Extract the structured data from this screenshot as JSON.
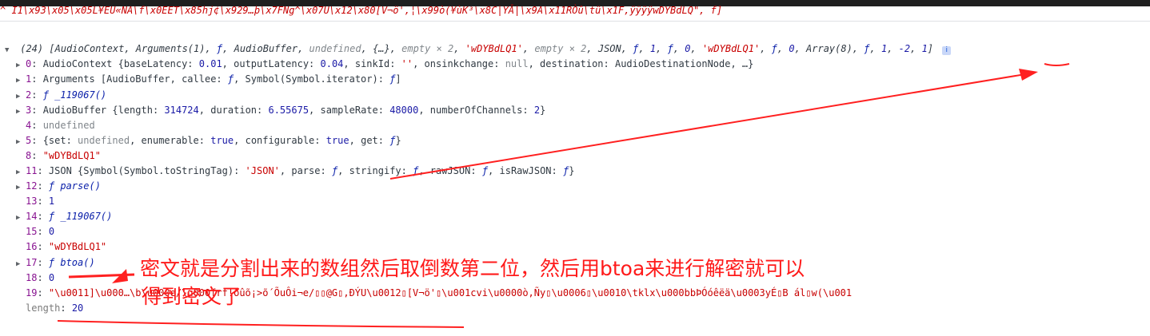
{
  "top_string": "^ I1\\x93\\x05\\x05L¥EU«NA\\f\\x0EET\\x85hj¢\\x929…þ\\x7FNg^\\x07U\\x12\\x80[V¬ö',¦\\x99ò(¥ùK³\\x8C|YÂ|\\x9A\\x11RÒû\\tü\\x1F,ÿÿÿÿwDYBdLQ\", f]",
  "array_header": {
    "count": "(24)",
    "open": "[",
    "items": [
      {
        "text": "AudioContext",
        "cls": ""
      },
      {
        "text": ", ",
        "cls": ""
      },
      {
        "text": "Arguments(1)",
        "cls": ""
      },
      {
        "text": ", ",
        "cls": ""
      },
      {
        "text": "ƒ",
        "cls": "f"
      },
      {
        "text": ", ",
        "cls": ""
      },
      {
        "text": "AudioBuffer",
        "cls": ""
      },
      {
        "text": ", ",
        "cls": ""
      },
      {
        "text": "undefined",
        "cls": "gray"
      },
      {
        "text": ", ",
        "cls": ""
      },
      {
        "text": "{…}",
        "cls": ""
      },
      {
        "text": ", ",
        "cls": ""
      },
      {
        "text": "empty × 2",
        "cls": "gray"
      },
      {
        "text": ", ",
        "cls": ""
      },
      {
        "text": "'wDYBdLQ1'",
        "cls": "str"
      },
      {
        "text": ", ",
        "cls": ""
      },
      {
        "text": "empty × 2",
        "cls": "gray"
      },
      {
        "text": ", ",
        "cls": ""
      },
      {
        "text": "JSON",
        "cls": ""
      },
      {
        "text": ", ",
        "cls": ""
      },
      {
        "text": "ƒ",
        "cls": "f"
      },
      {
        "text": ", ",
        "cls": ""
      },
      {
        "text": "1",
        "cls": "num"
      },
      {
        "text": ", ",
        "cls": ""
      },
      {
        "text": "ƒ",
        "cls": "f"
      },
      {
        "text": ", ",
        "cls": ""
      },
      {
        "text": "0",
        "cls": "num"
      },
      {
        "text": ", ",
        "cls": ""
      },
      {
        "text": "'wDYBdLQ1'",
        "cls": "str"
      },
      {
        "text": ", ",
        "cls": ""
      },
      {
        "text": "ƒ",
        "cls": "f"
      },
      {
        "text": ", ",
        "cls": ""
      },
      {
        "text": "0",
        "cls": "num"
      },
      {
        "text": ", ",
        "cls": ""
      },
      {
        "text": "Array(8)",
        "cls": ""
      },
      {
        "text": ", ",
        "cls": ""
      },
      {
        "text": "ƒ",
        "cls": "f"
      },
      {
        "text": ", ",
        "cls": ""
      },
      {
        "text": "1",
        "cls": "num"
      },
      {
        "text": ", ",
        "cls": ""
      },
      {
        "text": "-2",
        "cls": "num"
      },
      {
        "text": ", ",
        "cls": ""
      },
      {
        "text": "1",
        "cls": "num"
      }
    ],
    "close": "]",
    "info": "i"
  },
  "rows": [
    {
      "arrow": "▶",
      "key": "0",
      "segments": [
        {
          "t": "AudioContext {baseLatency: ",
          "c": ""
        },
        {
          "t": "0.01",
          "c": "num"
        },
        {
          "t": ", outputLatency: ",
          "c": ""
        },
        {
          "t": "0.04",
          "c": "num"
        },
        {
          "t": ", sinkId: ",
          "c": ""
        },
        {
          "t": "''",
          "c": "str"
        },
        {
          "t": ", onsinkchange: ",
          "c": ""
        },
        {
          "t": "null",
          "c": "gray"
        },
        {
          "t": ", destination: AudioDestinationNode, …}",
          "c": ""
        }
      ]
    },
    {
      "arrow": "▶",
      "key": "1",
      "segments": [
        {
          "t": "Arguments [AudioBuffer, callee: ",
          "c": ""
        },
        {
          "t": "ƒ",
          "c": "f"
        },
        {
          "t": ", Symbol(Symbol.iterator): ",
          "c": ""
        },
        {
          "t": "ƒ",
          "c": "f"
        },
        {
          "t": "]",
          "c": ""
        }
      ]
    },
    {
      "arrow": "▶",
      "key": "2",
      "segments": [
        {
          "t": "ƒ _119067()",
          "c": "f"
        }
      ]
    },
    {
      "arrow": "▶",
      "key": "3",
      "segments": [
        {
          "t": "AudioBuffer {length: ",
          "c": ""
        },
        {
          "t": "314724",
          "c": "num"
        },
        {
          "t": ", duration: ",
          "c": ""
        },
        {
          "t": "6.55675",
          "c": "num"
        },
        {
          "t": ", sampleRate: ",
          "c": ""
        },
        {
          "t": "48000",
          "c": "num"
        },
        {
          "t": ", numberOfChannels: ",
          "c": ""
        },
        {
          "t": "2",
          "c": "num"
        },
        {
          "t": "}",
          "c": ""
        }
      ]
    },
    {
      "arrow": "",
      "key": "4",
      "segments": [
        {
          "t": "undefined",
          "c": "gray"
        }
      ]
    },
    {
      "arrow": "▶",
      "key": "5",
      "segments": [
        {
          "t": "{set: ",
          "c": ""
        },
        {
          "t": "undefined",
          "c": "gray"
        },
        {
          "t": ", enumerable: ",
          "c": ""
        },
        {
          "t": "true",
          "c": "bool"
        },
        {
          "t": ", configurable: ",
          "c": ""
        },
        {
          "t": "true",
          "c": "bool"
        },
        {
          "t": ", get: ",
          "c": ""
        },
        {
          "t": "ƒ",
          "c": "f"
        },
        {
          "t": "}",
          "c": ""
        }
      ]
    },
    {
      "arrow": "",
      "key": "8",
      "segments": [
        {
          "t": "\"wDYBdLQ1\"",
          "c": "str"
        }
      ]
    },
    {
      "arrow": "▶",
      "key": "11",
      "segments": [
        {
          "t": "JSON {Symbol(Symbol.toStringTag): ",
          "c": ""
        },
        {
          "t": "'JSON'",
          "c": "str"
        },
        {
          "t": ", parse: ",
          "c": ""
        },
        {
          "t": "ƒ",
          "c": "f"
        },
        {
          "t": ", stringify: ",
          "c": ""
        },
        {
          "t": "ƒ",
          "c": "f"
        },
        {
          "t": ", rawJSON: ",
          "c": ""
        },
        {
          "t": "ƒ",
          "c": "f"
        },
        {
          "t": ", isRawJSON: ",
          "c": ""
        },
        {
          "t": "ƒ",
          "c": "f"
        },
        {
          "t": "}",
          "c": ""
        }
      ]
    },
    {
      "arrow": "▶",
      "key": "12",
      "segments": [
        {
          "t": "ƒ parse()",
          "c": "f"
        }
      ]
    },
    {
      "arrow": "",
      "key": "13",
      "segments": [
        {
          "t": "1",
          "c": "num"
        }
      ]
    },
    {
      "arrow": "▶",
      "key": "14",
      "segments": [
        {
          "t": "ƒ _119067()",
          "c": "f"
        }
      ]
    },
    {
      "arrow": "",
      "key": "15",
      "segments": [
        {
          "t": "0",
          "c": "num"
        }
      ]
    },
    {
      "arrow": "",
      "key": "16",
      "segments": [
        {
          "t": "\"wDYBdLQ1\"",
          "c": "str"
        }
      ]
    },
    {
      "arrow": "▶",
      "key": "17",
      "segments": [
        {
          "t": "ƒ btoa()",
          "c": "f"
        }
      ]
    },
    {
      "arrow": "",
      "key": "18",
      "segments": [
        {
          "t": "0",
          "c": "num"
        }
      ]
    },
    {
      "arrow": "",
      "key": "19",
      "segments": [
        {
          "t": "\"\\u0011]\\u000…\\b\\u000e/\\u000frf!ðûõ¡>õ´ÕuÔi¬e/▯▯@G▯,ÐÝU\\u0012▯[V¬ö'▯\\u001cvi\\u0000ò,Ñy▯\\u0006▯\\u0010\\tklx\\u000bbÞÓóêëä\\u0003yÉ▯B ál▯w(\\u001",
          "c": "str"
        }
      ]
    },
    {
      "arrow": "",
      "key": "length",
      "segments": [
        {
          "t": "20",
          "c": "num"
        }
      ]
    }
  ],
  "annotation": {
    "line1": "密文就是分割出来的数组然后取倒数第二位，然后用btoa来进行解密就可以",
    "line2": "得到密文了"
  },
  "colors": {
    "annotation": "#ff1a1a",
    "string": "#c80000",
    "number": "#1a1aa6",
    "key": "#881391"
  }
}
